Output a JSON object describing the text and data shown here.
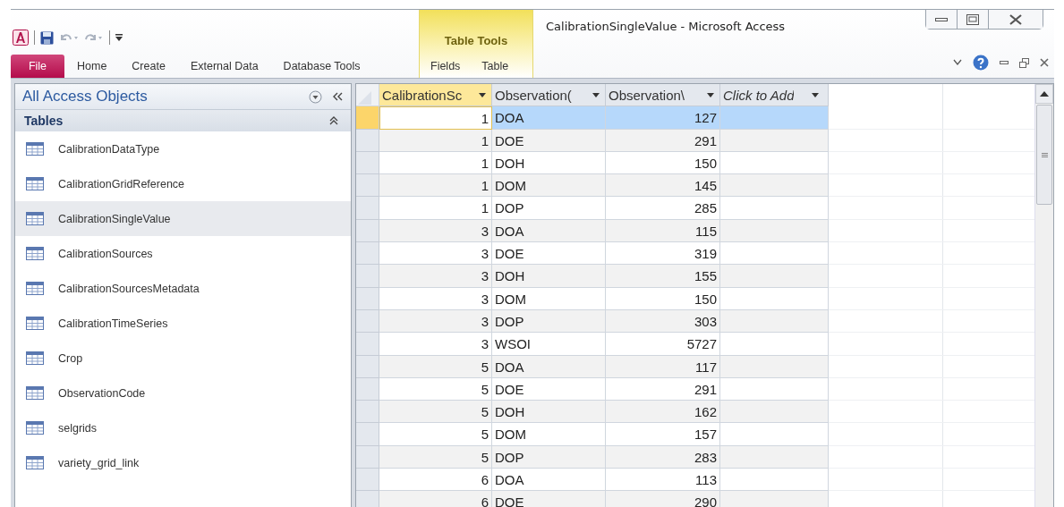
{
  "window": {
    "title": "CalibrationSingleValue  -  Microsoft Access"
  },
  "contextual_group": {
    "label": "Table Tools"
  },
  "ribbon_tabs": [
    {
      "label": "File",
      "kind": "backstage"
    },
    {
      "label": "Home",
      "kind": "normal"
    },
    {
      "label": "Create",
      "kind": "normal"
    },
    {
      "label": "External Data",
      "kind": "normal"
    },
    {
      "label": "Database Tools",
      "kind": "normal"
    },
    {
      "label": "Fields",
      "kind": "contextual"
    },
    {
      "label": "Table",
      "kind": "contextual"
    }
  ],
  "navigation_pane": {
    "title": "All Access Objects",
    "group": "Tables",
    "items": [
      {
        "label": "CalibrationDataType",
        "selected": false
      },
      {
        "label": "CalibrationGridReference",
        "selected": false
      },
      {
        "label": "CalibrationSingleValue",
        "selected": true
      },
      {
        "label": "CalibrationSources",
        "selected": false
      },
      {
        "label": "CalibrationSourcesMetadata",
        "selected": false
      },
      {
        "label": "CalibrationTimeSeries",
        "selected": false
      },
      {
        "label": "Crop",
        "selected": false
      },
      {
        "label": "ObservationCode",
        "selected": false
      },
      {
        "label": "selgrids",
        "selected": false
      },
      {
        "label": "variety_grid_link",
        "selected": false
      }
    ]
  },
  "table": {
    "columns": [
      {
        "label": "CalibrationSc",
        "kind": "field",
        "selected": true
      },
      {
        "label": "Observation(",
        "kind": "field",
        "selected": false
      },
      {
        "label": "Observation\\",
        "kind": "field",
        "selected": false
      },
      {
        "label": "Click to Add",
        "kind": "add",
        "selected": false
      }
    ],
    "rows": [
      {
        "cells": [
          "1",
          "DOA",
          "127"
        ],
        "selected": true
      },
      {
        "cells": [
          "1",
          "DOE",
          "291"
        ],
        "selected": false
      },
      {
        "cells": [
          "1",
          "DOH",
          "150"
        ],
        "selected": false
      },
      {
        "cells": [
          "1",
          "DOM",
          "145"
        ],
        "selected": false
      },
      {
        "cells": [
          "1",
          "DOP",
          "285"
        ],
        "selected": false
      },
      {
        "cells": [
          "3",
          "DOA",
          "115"
        ],
        "selected": false
      },
      {
        "cells": [
          "3",
          "DOE",
          "319"
        ],
        "selected": false
      },
      {
        "cells": [
          "3",
          "DOH",
          "155"
        ],
        "selected": false
      },
      {
        "cells": [
          "3",
          "DOM",
          "150"
        ],
        "selected": false
      },
      {
        "cells": [
          "3",
          "DOP",
          "303"
        ],
        "selected": false
      },
      {
        "cells": [
          "3",
          "WSOI",
          "5727"
        ],
        "selected": false
      },
      {
        "cells": [
          "5",
          "DOA",
          "117"
        ],
        "selected": false
      },
      {
        "cells": [
          "5",
          "DOE",
          "291"
        ],
        "selected": false
      },
      {
        "cells": [
          "5",
          "DOH",
          "162"
        ],
        "selected": false
      },
      {
        "cells": [
          "5",
          "DOM",
          "157"
        ],
        "selected": false
      },
      {
        "cells": [
          "5",
          "DOP",
          "283"
        ],
        "selected": false
      },
      {
        "cells": [
          "6",
          "DOA",
          "113"
        ],
        "selected": false
      },
      {
        "cells": [
          "6",
          "DOE",
          "290"
        ],
        "selected": false
      }
    ]
  }
}
